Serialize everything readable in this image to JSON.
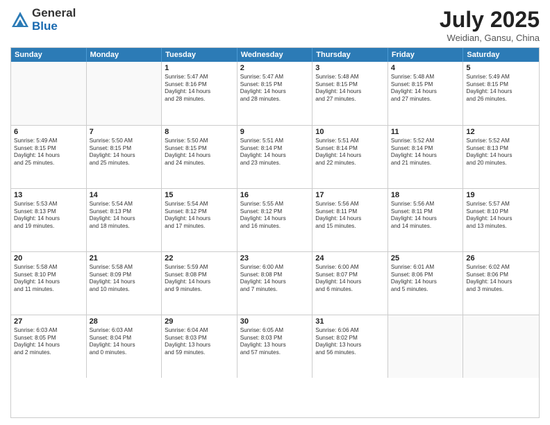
{
  "logo": {
    "general": "General",
    "blue": "Blue"
  },
  "title": "July 2025",
  "location": "Weidian, Gansu, China",
  "days": [
    "Sunday",
    "Monday",
    "Tuesday",
    "Wednesday",
    "Thursday",
    "Friday",
    "Saturday"
  ],
  "weeks": [
    [
      {
        "day": "",
        "lines": []
      },
      {
        "day": "",
        "lines": []
      },
      {
        "day": "1",
        "lines": [
          "Sunrise: 5:47 AM",
          "Sunset: 8:16 PM",
          "Daylight: 14 hours",
          "and 28 minutes."
        ]
      },
      {
        "day": "2",
        "lines": [
          "Sunrise: 5:47 AM",
          "Sunset: 8:15 PM",
          "Daylight: 14 hours",
          "and 28 minutes."
        ]
      },
      {
        "day": "3",
        "lines": [
          "Sunrise: 5:48 AM",
          "Sunset: 8:15 PM",
          "Daylight: 14 hours",
          "and 27 minutes."
        ]
      },
      {
        "day": "4",
        "lines": [
          "Sunrise: 5:48 AM",
          "Sunset: 8:15 PM",
          "Daylight: 14 hours",
          "and 27 minutes."
        ]
      },
      {
        "day": "5",
        "lines": [
          "Sunrise: 5:49 AM",
          "Sunset: 8:15 PM",
          "Daylight: 14 hours",
          "and 26 minutes."
        ]
      }
    ],
    [
      {
        "day": "6",
        "lines": [
          "Sunrise: 5:49 AM",
          "Sunset: 8:15 PM",
          "Daylight: 14 hours",
          "and 25 minutes."
        ]
      },
      {
        "day": "7",
        "lines": [
          "Sunrise: 5:50 AM",
          "Sunset: 8:15 PM",
          "Daylight: 14 hours",
          "and 25 minutes."
        ]
      },
      {
        "day": "8",
        "lines": [
          "Sunrise: 5:50 AM",
          "Sunset: 8:15 PM",
          "Daylight: 14 hours",
          "and 24 minutes."
        ]
      },
      {
        "day": "9",
        "lines": [
          "Sunrise: 5:51 AM",
          "Sunset: 8:14 PM",
          "Daylight: 14 hours",
          "and 23 minutes."
        ]
      },
      {
        "day": "10",
        "lines": [
          "Sunrise: 5:51 AM",
          "Sunset: 8:14 PM",
          "Daylight: 14 hours",
          "and 22 minutes."
        ]
      },
      {
        "day": "11",
        "lines": [
          "Sunrise: 5:52 AM",
          "Sunset: 8:14 PM",
          "Daylight: 14 hours",
          "and 21 minutes."
        ]
      },
      {
        "day": "12",
        "lines": [
          "Sunrise: 5:52 AM",
          "Sunset: 8:13 PM",
          "Daylight: 14 hours",
          "and 20 minutes."
        ]
      }
    ],
    [
      {
        "day": "13",
        "lines": [
          "Sunrise: 5:53 AM",
          "Sunset: 8:13 PM",
          "Daylight: 14 hours",
          "and 19 minutes."
        ]
      },
      {
        "day": "14",
        "lines": [
          "Sunrise: 5:54 AM",
          "Sunset: 8:13 PM",
          "Daylight: 14 hours",
          "and 18 minutes."
        ]
      },
      {
        "day": "15",
        "lines": [
          "Sunrise: 5:54 AM",
          "Sunset: 8:12 PM",
          "Daylight: 14 hours",
          "and 17 minutes."
        ]
      },
      {
        "day": "16",
        "lines": [
          "Sunrise: 5:55 AM",
          "Sunset: 8:12 PM",
          "Daylight: 14 hours",
          "and 16 minutes."
        ]
      },
      {
        "day": "17",
        "lines": [
          "Sunrise: 5:56 AM",
          "Sunset: 8:11 PM",
          "Daylight: 14 hours",
          "and 15 minutes."
        ]
      },
      {
        "day": "18",
        "lines": [
          "Sunrise: 5:56 AM",
          "Sunset: 8:11 PM",
          "Daylight: 14 hours",
          "and 14 minutes."
        ]
      },
      {
        "day": "19",
        "lines": [
          "Sunrise: 5:57 AM",
          "Sunset: 8:10 PM",
          "Daylight: 14 hours",
          "and 13 minutes."
        ]
      }
    ],
    [
      {
        "day": "20",
        "lines": [
          "Sunrise: 5:58 AM",
          "Sunset: 8:10 PM",
          "Daylight: 14 hours",
          "and 11 minutes."
        ]
      },
      {
        "day": "21",
        "lines": [
          "Sunrise: 5:58 AM",
          "Sunset: 8:09 PM",
          "Daylight: 14 hours",
          "and 10 minutes."
        ]
      },
      {
        "day": "22",
        "lines": [
          "Sunrise: 5:59 AM",
          "Sunset: 8:08 PM",
          "Daylight: 14 hours",
          "and 9 minutes."
        ]
      },
      {
        "day": "23",
        "lines": [
          "Sunrise: 6:00 AM",
          "Sunset: 8:08 PM",
          "Daylight: 14 hours",
          "and 7 minutes."
        ]
      },
      {
        "day": "24",
        "lines": [
          "Sunrise: 6:00 AM",
          "Sunset: 8:07 PM",
          "Daylight: 14 hours",
          "and 6 minutes."
        ]
      },
      {
        "day": "25",
        "lines": [
          "Sunrise: 6:01 AM",
          "Sunset: 8:06 PM",
          "Daylight: 14 hours",
          "and 5 minutes."
        ]
      },
      {
        "day": "26",
        "lines": [
          "Sunrise: 6:02 AM",
          "Sunset: 8:06 PM",
          "Daylight: 14 hours",
          "and 3 minutes."
        ]
      }
    ],
    [
      {
        "day": "27",
        "lines": [
          "Sunrise: 6:03 AM",
          "Sunset: 8:05 PM",
          "Daylight: 14 hours",
          "and 2 minutes."
        ]
      },
      {
        "day": "28",
        "lines": [
          "Sunrise: 6:03 AM",
          "Sunset: 8:04 PM",
          "Daylight: 14 hours",
          "and 0 minutes."
        ]
      },
      {
        "day": "29",
        "lines": [
          "Sunrise: 6:04 AM",
          "Sunset: 8:03 PM",
          "Daylight: 13 hours",
          "and 59 minutes."
        ]
      },
      {
        "day": "30",
        "lines": [
          "Sunrise: 6:05 AM",
          "Sunset: 8:03 PM",
          "Daylight: 13 hours",
          "and 57 minutes."
        ]
      },
      {
        "day": "31",
        "lines": [
          "Sunrise: 6:06 AM",
          "Sunset: 8:02 PM",
          "Daylight: 13 hours",
          "and 56 minutes."
        ]
      },
      {
        "day": "",
        "lines": []
      },
      {
        "day": "",
        "lines": []
      }
    ]
  ]
}
